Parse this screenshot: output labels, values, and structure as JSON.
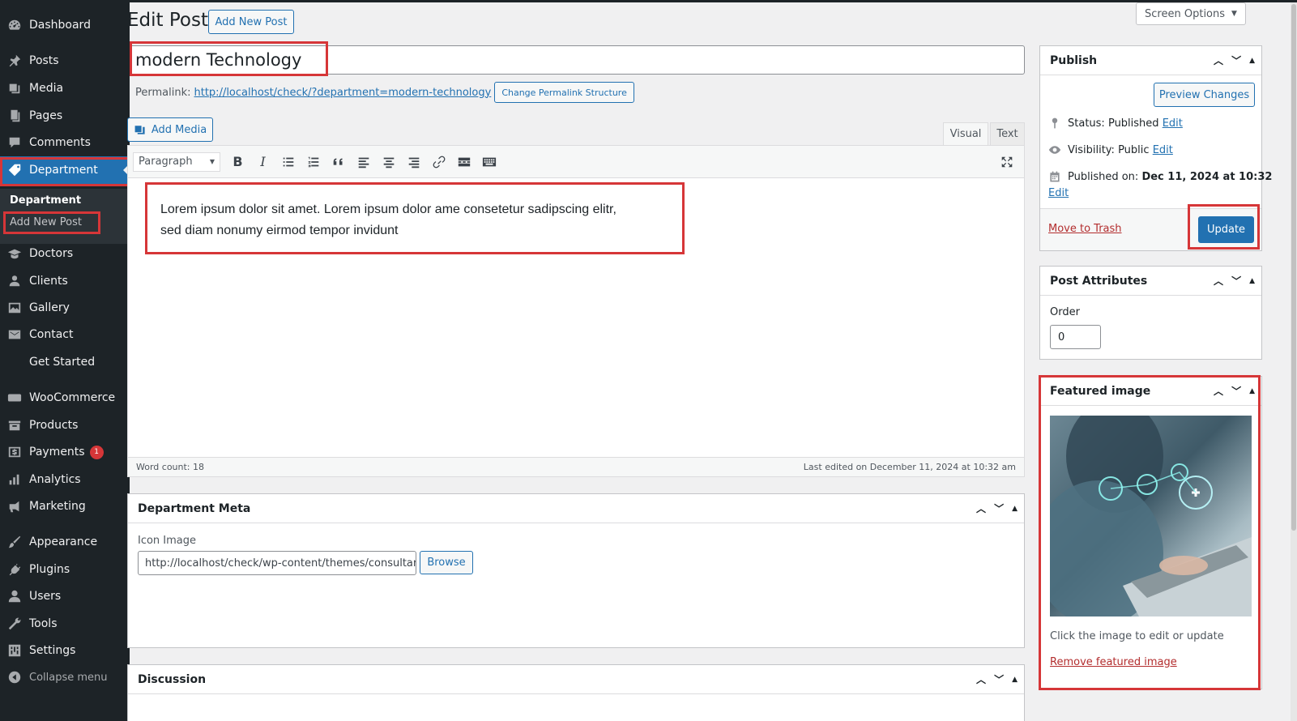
{
  "sidebar": {
    "items": [
      {
        "label": "Dashboard",
        "icon": "dashboard-icon"
      },
      {
        "label": "Posts",
        "icon": "pin-icon"
      },
      {
        "label": "Media",
        "icon": "media-icon"
      },
      {
        "label": "Pages",
        "icon": "pages-icon"
      },
      {
        "label": "Comments",
        "icon": "comments-icon"
      },
      {
        "label": "Department",
        "icon": "tag-icon"
      },
      {
        "label": "Doctors",
        "icon": "graduation-cap-icon"
      },
      {
        "label": "Clients",
        "icon": "users-icon"
      },
      {
        "label": "Gallery",
        "icon": "gallery-icon"
      },
      {
        "label": "Contact",
        "icon": "envelope-icon"
      },
      {
        "label": "Get Started",
        "icon": ""
      },
      {
        "label": "WooCommerce",
        "icon": "woo-icon"
      },
      {
        "label": "Products",
        "icon": "archive-icon"
      },
      {
        "label": "Payments",
        "icon": "dollar-icon",
        "badge": "1"
      },
      {
        "label": "Analytics",
        "icon": "chart-bar-icon"
      },
      {
        "label": "Marketing",
        "icon": "megaphone-icon"
      },
      {
        "label": "Appearance",
        "icon": "brush-icon"
      },
      {
        "label": "Plugins",
        "icon": "plug-icon"
      },
      {
        "label": "Users",
        "icon": "user-icon"
      },
      {
        "label": "Tools",
        "icon": "wrench-icon"
      },
      {
        "label": "Settings",
        "icon": "settings-icon"
      },
      {
        "label": "Collapse menu",
        "icon": "collapse-icon"
      }
    ],
    "submenu": {
      "title": "Department",
      "add_new": "Add New Post"
    }
  },
  "header": {
    "title": "Edit Post",
    "add_new": "Add New Post",
    "screen_options": "Screen Options"
  },
  "post": {
    "title": "modern Technology",
    "permalink_label": "Permalink:",
    "permalink_url": "http://localhost/check/?department=modern-technology",
    "change_permalink": "Change Permalink Structure",
    "add_media": "Add Media",
    "tab_visual": "Visual",
    "tab_text": "Text",
    "format_select": "Paragraph",
    "content_line1": "Lorem ipsum dolor sit amet. Lorem ipsum dolor ame consetetur sadipscing elitr,",
    "content_line2": "sed diam nonumy eirmod tempor invidunt",
    "word_count": "Word count: 18",
    "last_edited": "Last edited on December 11, 2024 at 10:32 am"
  },
  "department_meta": {
    "title": "Department Meta",
    "icon_label": "Icon Image",
    "icon_value": "http://localhost/check/wp-content/themes/consultar",
    "browse": "Browse"
  },
  "discussion": {
    "title": "Discussion"
  },
  "publish": {
    "title": "Publish",
    "preview": "Preview Changes",
    "status_label": "Status:",
    "status_value": "Published",
    "visibility_label": "Visibility:",
    "visibility_value": "Public",
    "published_label": "Published on:",
    "published_value": "Dec 11, 2024 at 10:32",
    "edit": "Edit",
    "trash": "Move to Trash",
    "update": "Update"
  },
  "attributes": {
    "title": "Post Attributes",
    "order_label": "Order",
    "order_value": "0"
  },
  "featured": {
    "title": "Featured image",
    "hint": "Click the image to edit or update",
    "remove": "Remove featured image"
  },
  "colors": {
    "sidebar_bg": "#1d2327",
    "accent": "#2271b1",
    "highlight_box": "#d63638"
  }
}
